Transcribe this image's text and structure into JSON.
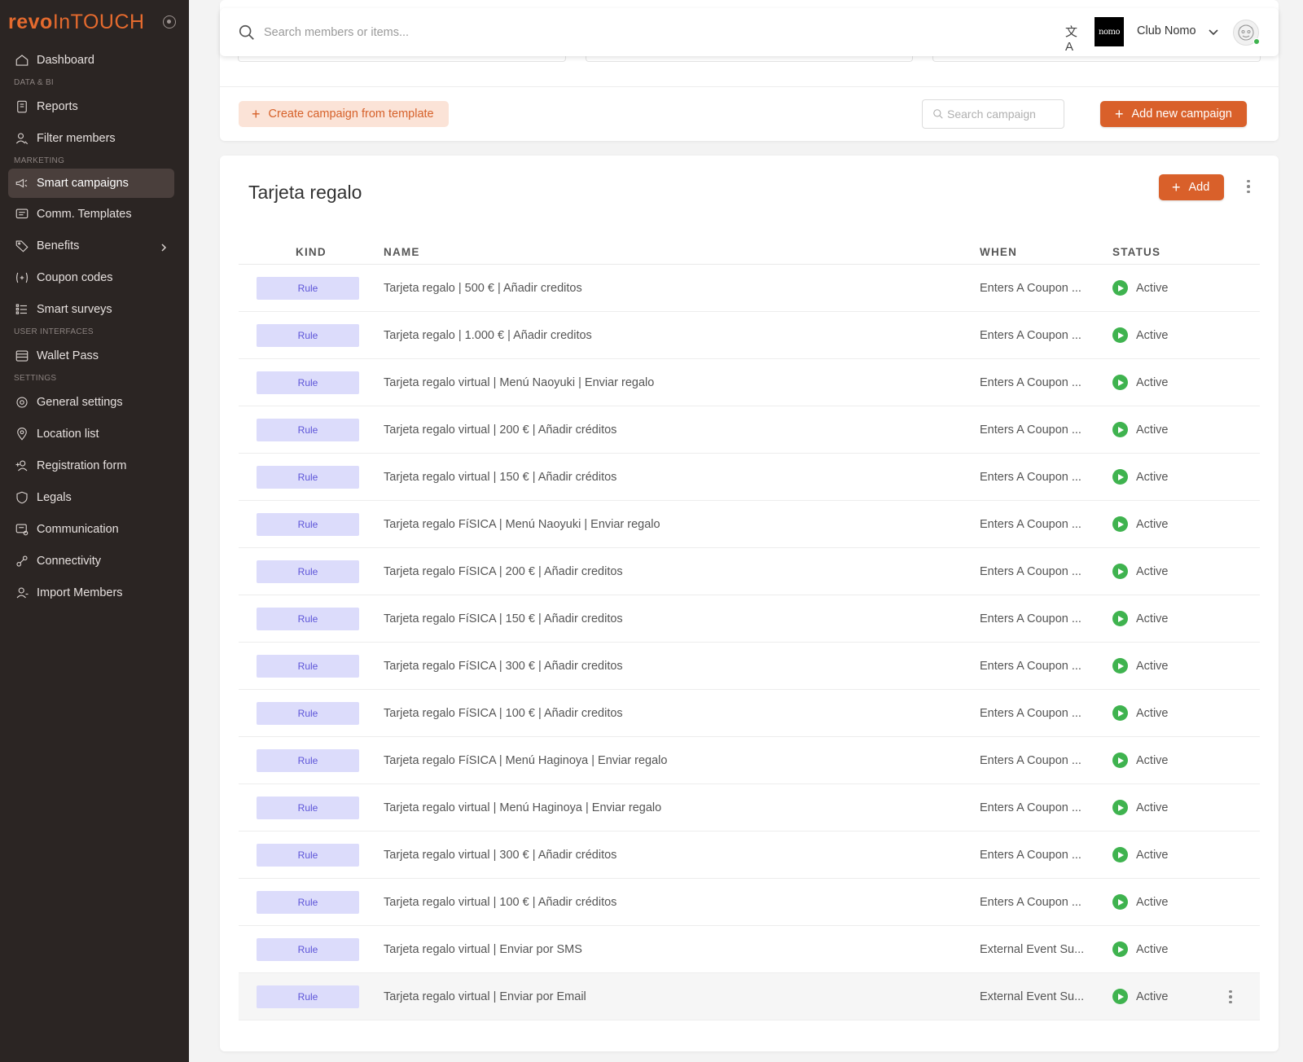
{
  "app": {
    "logo_prefix": "revo",
    "logo_suffix": "InTOUCH",
    "brand_color": "#d9602a"
  },
  "sidebar": {
    "items": [
      {
        "type": "item",
        "label": "Dashboard",
        "icon": "home-icon"
      },
      {
        "type": "section",
        "label": "DATA & BI"
      },
      {
        "type": "item",
        "label": "Reports",
        "icon": "reports-icon"
      },
      {
        "type": "item",
        "label": "Filter members",
        "icon": "user-filter-icon"
      },
      {
        "type": "section",
        "label": "MARKETING"
      },
      {
        "type": "item",
        "label": "Smart campaigns",
        "icon": "megaphone-icon",
        "active": true
      },
      {
        "type": "item",
        "label": "Comm. Templates",
        "icon": "message-icon"
      },
      {
        "type": "item",
        "label": "Benefits",
        "icon": "tag-icon",
        "chevron": true
      },
      {
        "type": "item",
        "label": "Coupon codes",
        "icon": "coupon-icon"
      },
      {
        "type": "item",
        "label": "Smart surveys",
        "icon": "list-icon"
      },
      {
        "type": "section",
        "label": "USER INTERFACES"
      },
      {
        "type": "item",
        "label": "Wallet Pass",
        "icon": "wallet-icon"
      },
      {
        "type": "section",
        "label": "SETTINGS"
      },
      {
        "type": "item",
        "label": "General settings",
        "icon": "gear-icon"
      },
      {
        "type": "item",
        "label": "Location list",
        "icon": "pin-icon"
      },
      {
        "type": "item",
        "label": "Registration form",
        "icon": "user-add-icon"
      },
      {
        "type": "item",
        "label": "Legals",
        "icon": "shield-icon"
      },
      {
        "type": "item",
        "label": "Communication",
        "icon": "chat-settings-icon"
      },
      {
        "type": "item",
        "label": "Connectivity",
        "icon": "connect-icon"
      },
      {
        "type": "item",
        "label": "Import Members",
        "icon": "user-import-icon"
      }
    ]
  },
  "topbar": {
    "search_placeholder": "Search members or items...",
    "club_logo_text": "nomo",
    "club_name": "Club Nomo"
  },
  "toolbar": {
    "template_label": "Create campaign from template",
    "search_placeholder": "Search campaign",
    "add_campaign_label": "Add new campaign"
  },
  "section": {
    "title": "Tarjeta regalo",
    "add_label": "Add"
  },
  "table": {
    "headers": {
      "kind": "KIND",
      "name": "NAME",
      "when": "WHEN",
      "status": "STATUS"
    },
    "rows": [
      {
        "kind": "Rule",
        "name": "Tarjeta regalo | 500 € | Añadir creditos",
        "when": "Enters A Coupon ...",
        "status": "Active"
      },
      {
        "kind": "Rule",
        "name": "Tarjeta regalo | 1.000 € | Añadir creditos",
        "when": "Enters A Coupon ...",
        "status": "Active"
      },
      {
        "kind": "Rule",
        "name": "Tarjeta regalo virtual | Menú Naoyuki | Enviar regalo",
        "when": "Enters A Coupon ...",
        "status": "Active"
      },
      {
        "kind": "Rule",
        "name": "Tarjeta regalo virtual | 200 € | Añadir créditos",
        "when": "Enters A Coupon ...",
        "status": "Active"
      },
      {
        "kind": "Rule",
        "name": "Tarjeta regalo virtual | 150 € | Añadir créditos",
        "when": "Enters A Coupon ...",
        "status": "Active"
      },
      {
        "kind": "Rule",
        "name": "Tarjeta regalo FíSICA | Menú Naoyuki | Enviar regalo",
        "when": "Enters A Coupon ...",
        "status": "Active"
      },
      {
        "kind": "Rule",
        "name": "Tarjeta regalo FíSICA | 200 € | Añadir creditos",
        "when": "Enters A Coupon ...",
        "status": "Active"
      },
      {
        "kind": "Rule",
        "name": "Tarjeta regalo FíSICA | 150 € | Añadir creditos",
        "when": "Enters A Coupon ...",
        "status": "Active"
      },
      {
        "kind": "Rule",
        "name": "Tarjeta regalo FíSICA | 300 € | Añadir creditos",
        "when": "Enters A Coupon ...",
        "status": "Active"
      },
      {
        "kind": "Rule",
        "name": "Tarjeta regalo FíSICA | 100 € | Añadir creditos",
        "when": "Enters A Coupon ...",
        "status": "Active"
      },
      {
        "kind": "Rule",
        "name": "Tarjeta regalo FíSICA | Menú Haginoya | Enviar regalo",
        "when": "Enters A Coupon ...",
        "status": "Active"
      },
      {
        "kind": "Rule",
        "name": "Tarjeta regalo virtual | Menú Haginoya | Enviar regalo",
        "when": "Enters A Coupon ...",
        "status": "Active"
      },
      {
        "kind": "Rule",
        "name": "Tarjeta regalo virtual | 300 € | Añadir créditos",
        "when": "Enters A Coupon ...",
        "status": "Active"
      },
      {
        "kind": "Rule",
        "name": "Tarjeta regalo virtual | 100 € | Añadir créditos",
        "when": "Enters A Coupon ...",
        "status": "Active"
      },
      {
        "kind": "Rule",
        "name": "Tarjeta regalo virtual | Enviar por SMS",
        "when": "External Event Su...",
        "status": "Active"
      },
      {
        "kind": "Rule",
        "name": "Tarjeta regalo virtual | Enviar por Email",
        "when": "External Event Su...",
        "status": "Active",
        "hovered": true
      }
    ]
  }
}
